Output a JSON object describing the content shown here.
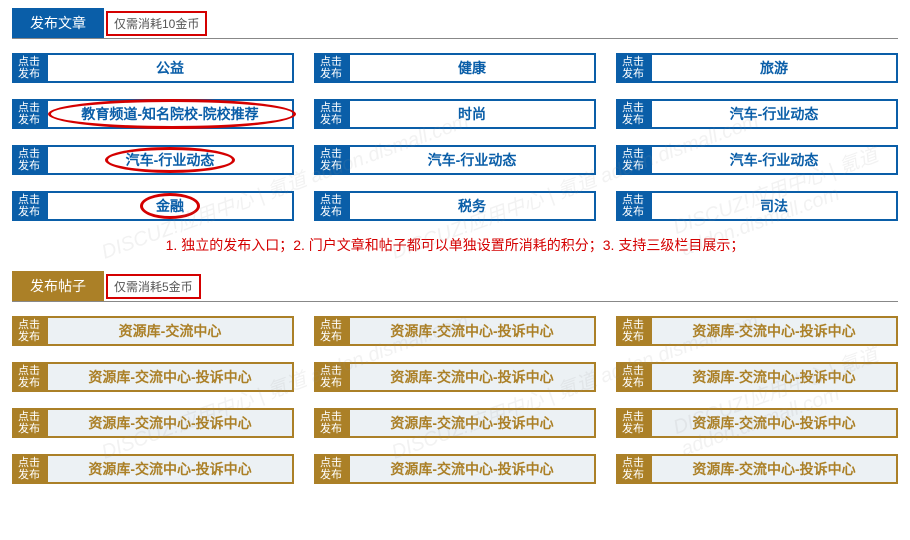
{
  "section1": {
    "tab": "发布文章",
    "cost": "仅需消耗10金币",
    "btn_line1": "点击",
    "btn_line2": "发布",
    "items": [
      {
        "label": "公益"
      },
      {
        "label": "健康"
      },
      {
        "label": "旅游"
      },
      {
        "label": "教育频道-知名院校-院校推荐",
        "circled": "wide"
      },
      {
        "label": "时尚"
      },
      {
        "label": "汽车-行业动态"
      },
      {
        "label": "汽车-行业动态",
        "circled": "mid"
      },
      {
        "label": "汽车-行业动态"
      },
      {
        "label": "汽车-行业动态"
      },
      {
        "label": "金融",
        "circled": "small"
      },
      {
        "label": "税务"
      },
      {
        "label": "司法"
      }
    ]
  },
  "note": "1. 独立的发布入口；2. 门户文章和帖子都可以单独设置所消耗的积分；3. 支持三级栏目展示；",
  "section2": {
    "tab": "发布帖子",
    "cost": "仅需消耗5金币",
    "btn_line1": "点击",
    "btn_line2": "发布",
    "items": [
      {
        "label": "资源库-交流中心"
      },
      {
        "label": "资源库-交流中心-投诉中心"
      },
      {
        "label": "资源库-交流中心-投诉中心"
      },
      {
        "label": "资源库-交流中心-投诉中心"
      },
      {
        "label": "资源库-交流中心-投诉中心"
      },
      {
        "label": "资源库-交流中心-投诉中心"
      },
      {
        "label": "资源库-交流中心-投诉中心"
      },
      {
        "label": "资源库-交流中心-投诉中心"
      },
      {
        "label": "资源库-交流中心-投诉中心"
      },
      {
        "label": "资源库-交流中心-投诉中心"
      },
      {
        "label": "资源库-交流中心-投诉中心"
      },
      {
        "label": "资源库-交流中心-投诉中心"
      }
    ]
  },
  "watermark": "DISCUZ!应用中心 | 氪道 addon.dismall.com"
}
